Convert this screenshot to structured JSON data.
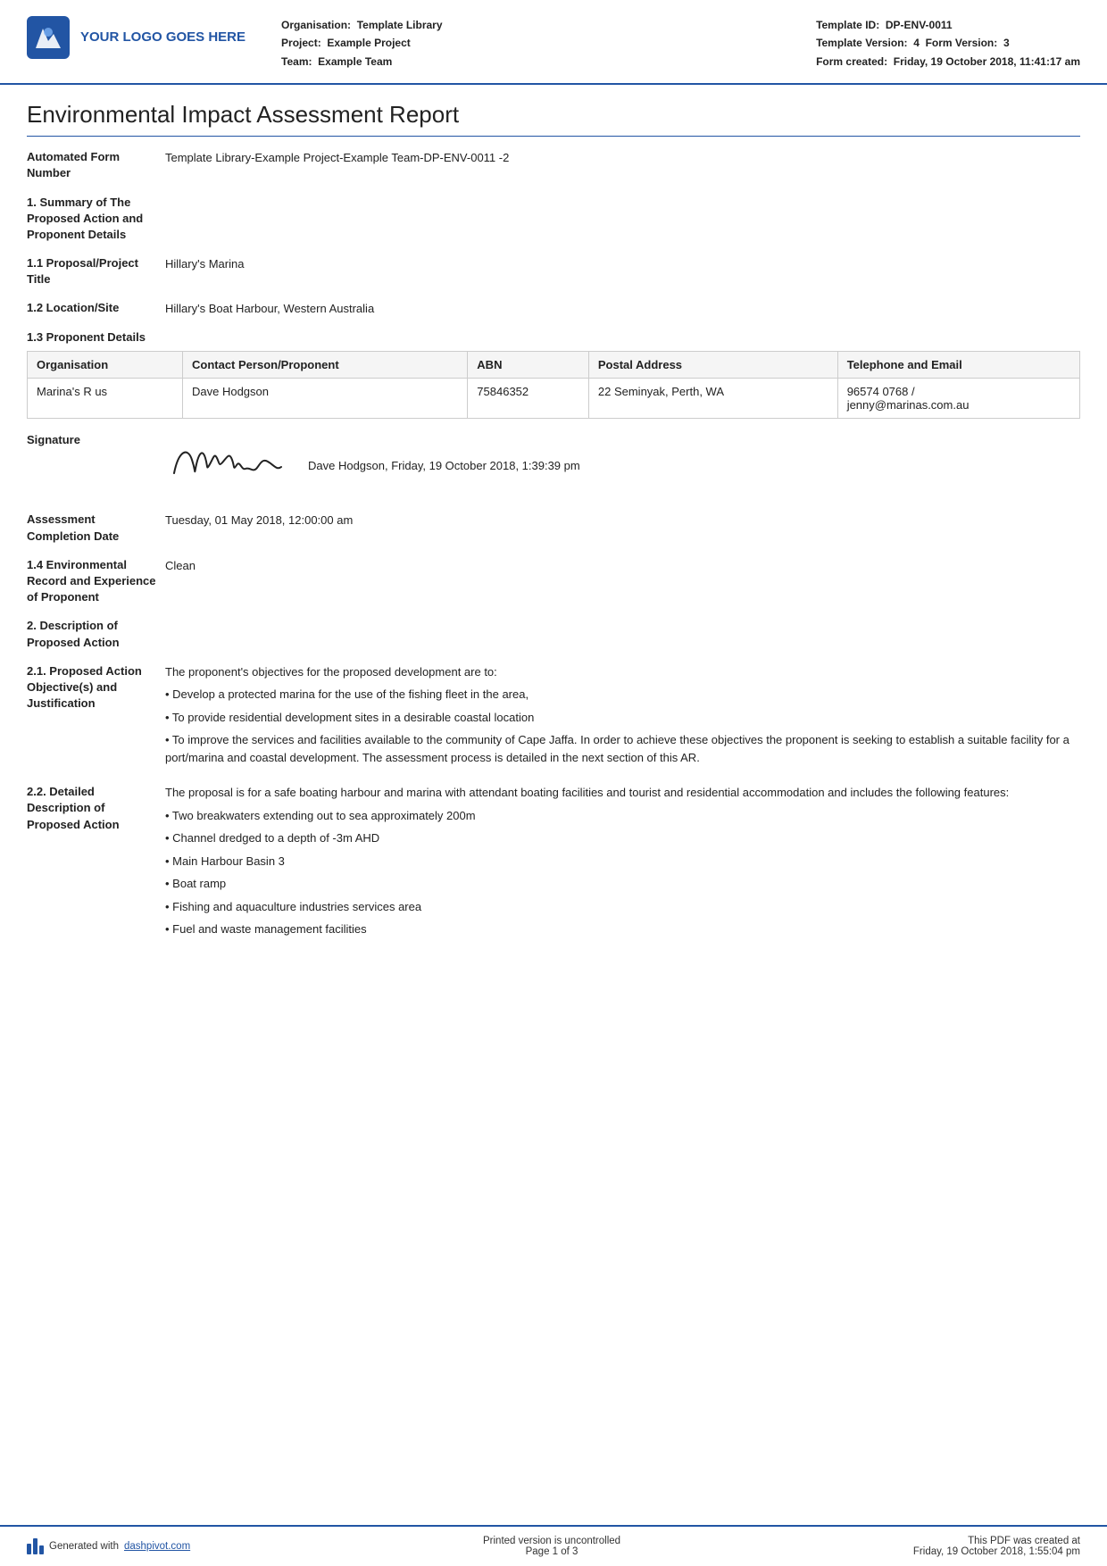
{
  "header": {
    "logo_text": "YOUR LOGO GOES HERE",
    "org_label": "Organisation:",
    "org_value": "Template Library",
    "project_label": "Project:",
    "project_value": "Example Project",
    "team_label": "Team:",
    "team_value": "Example Team",
    "template_id_label": "Template ID:",
    "template_id_value": "DP-ENV-0011",
    "template_version_label": "Template Version:",
    "template_version_value": "4",
    "form_version_label": "Form Version:",
    "form_version_value": "3",
    "form_created_label": "Form created:",
    "form_created_value": "Friday, 19 October 2018, 11:41:17 am"
  },
  "report": {
    "title": "Environmental Impact Assessment Report",
    "automated_form_number_label": "Automated Form Number",
    "automated_form_number_value": "Template Library-Example Project-Example Team-DP-ENV-0011  -2",
    "section1_label": "1. Summary of The Proposed Action and Proponent Details",
    "section1_1_label": "1.1 Proposal/Project Title",
    "section1_1_value": "Hillary's Marina",
    "section1_2_label": "1.2 Location/Site",
    "section1_2_value": "Hillary's Boat Harbour, Western Australia",
    "section1_3_label": "1.3 Proponent Details",
    "table": {
      "headers": [
        "Organisation",
        "Contact Person/Proponent",
        "ABN",
        "Postal Address",
        "Telephone and Email"
      ],
      "rows": [
        [
          "Marina's R us",
          "Dave Hodgson",
          "75846352",
          "22 Seminyak, Perth, WA",
          "96574 0768 / jenny@marinas.com.au"
        ]
      ]
    },
    "signature_label": "Signature",
    "signature_cursive": "Camall",
    "signature_info": "Dave Hodgson, Friday, 19 October 2018, 1:39:39 pm",
    "assessment_date_label": "Assessment Completion Date",
    "assessment_date_value": "Tuesday, 01 May 2018, 12:00:00 am",
    "section1_4_label": "1.4 Environmental Record and Experience of Proponent",
    "section1_4_value": "Clean",
    "section2_label": "2. Description of Proposed Action",
    "section2_1_label": "2.1. Proposed Action Objective(s) and Justification",
    "section2_1_intro": "The proponent's objectives for the proposed development are to:",
    "section2_1_bullets": [
      "• Develop a protected marina for the use of the fishing fleet in the area,",
      "• To provide residential development sites in a desirable coastal location",
      "• To improve the services and facilities available to the community of Cape Jaffa. In order to achieve these objectives the proponent is seeking to establish a suitable facility for a port/marina and coastal development. The assessment process is detailed in the next section of this AR."
    ],
    "section2_2_label": "2.2. Detailed Description of Proposed Action",
    "section2_2_intro": "The proposal is for a safe boating harbour and marina with attendant boating facilities and tourist and residential accommodation and includes the following features:",
    "section2_2_bullets": [
      "• Two breakwaters extending out to sea approximately 200m",
      "• Channel dredged to a depth of -3m AHD",
      "• Main Harbour Basin 3",
      "• Boat ramp",
      "• Fishing and aquaculture industries services area",
      "• Fuel and waste management facilities"
    ]
  },
  "footer": {
    "generated_text": "Generated with ",
    "generated_link": "dashpivot.com",
    "page_info": "Printed version is uncontrolled",
    "page_number": "Page 1 of 3",
    "pdf_created_label": "This PDF was created at",
    "pdf_created_value": "Friday, 19 October 2018, 1:55:04 pm"
  }
}
